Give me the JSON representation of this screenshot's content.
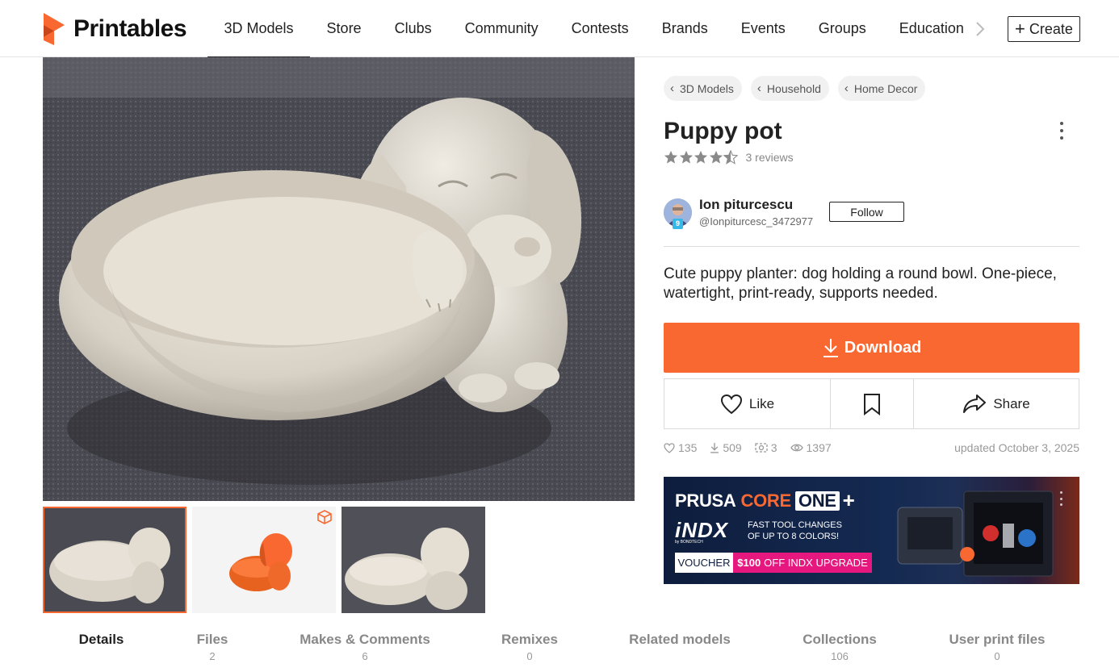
{
  "header": {
    "brand": "Printables",
    "nav": [
      "3D Models",
      "Store",
      "Clubs",
      "Community",
      "Contests",
      "Brands",
      "Events",
      "Groups",
      "Education"
    ],
    "active_nav": "3D Models",
    "create_label": "Create",
    "brand_color": "#fa6831"
  },
  "breadcrumbs": [
    "3D Models",
    "Household",
    "Home Decor"
  ],
  "model": {
    "title": "Puppy pot",
    "rating": 4.5,
    "reviews": "3 reviews",
    "summary": "Cute puppy planter: dog holding a round bowl. One-piece, watertight, print-ready, supports needed.",
    "updated": "updated October 3, 2025"
  },
  "author": {
    "name": "Ion piturcescu",
    "handle": "@Ionpiturcesc_3472977",
    "level": "9",
    "follow_label": "Follow"
  },
  "actions": {
    "download": "Download",
    "like": "Like",
    "share": "Share"
  },
  "stats": {
    "likes": "135",
    "downloads": "509",
    "makes": "3",
    "views": "1397"
  },
  "ad": {
    "brand_prusa": "PRUSA",
    "brand_core": "CORE",
    "brand_one": "ONE",
    "brand_plus": "+",
    "indx": "iNDX",
    "indx_sub": "by BONDTECH",
    "tagline_1": "FAST TOOL CHANGES",
    "tagline_2": "OF UP TO 8 COLORS!",
    "voucher": "VOUCHER",
    "offer_amount": "$100",
    "offer_text": "OFF INDX UPGRADE"
  },
  "tabs": [
    {
      "label": "Details",
      "count": ""
    },
    {
      "label": "Files",
      "count": "2"
    },
    {
      "label": "Makes & Comments",
      "count": "6"
    },
    {
      "label": "Remixes",
      "count": "0"
    },
    {
      "label": "Related models",
      "count": ""
    },
    {
      "label": "Collections",
      "count": "106"
    },
    {
      "label": "User print files",
      "count": "0"
    }
  ]
}
